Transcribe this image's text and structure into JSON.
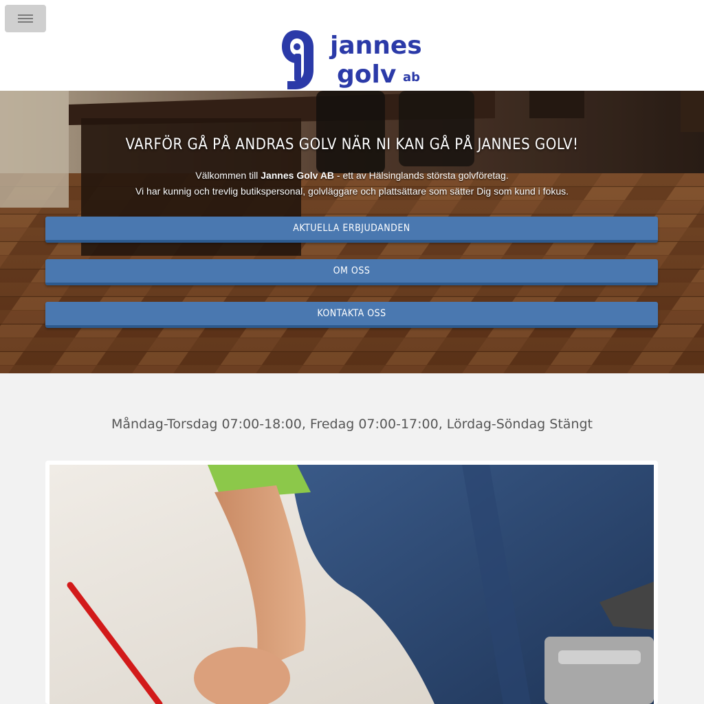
{
  "header": {
    "menu_icon": "hamburger-icon",
    "logo": {
      "line1": "jannes",
      "line2": "golv",
      "suffix": "ab",
      "color": "#2b3aa8"
    }
  },
  "hero": {
    "title": "VARFÖR GÅ PÅ ANDRAS GOLV NÄR NI KAN GÅ PÅ JANNES GOLV!",
    "intro_prefix": "Välkommen till ",
    "intro_brand": "Jannes Golv AB",
    "intro_suffix": " - ett av Hälsinglands största golvföretag.",
    "intro_line2": "Vi har kunnig och trevlig butikspersonal, golvläggare och plattsättare som sätter Dig som kund i fokus.",
    "buttons": [
      {
        "label": "AKTUELLA ERBJUDANDEN"
      },
      {
        "label": "OM OSS"
      },
      {
        "label": "KONTAKTA OSS"
      }
    ],
    "button_color": "#4a78b0"
  },
  "hours": {
    "text": "Måndag-Torsdag 07:00-18:00, Fredag 07:00-17:00, Lördag-Söndag Stängt"
  }
}
